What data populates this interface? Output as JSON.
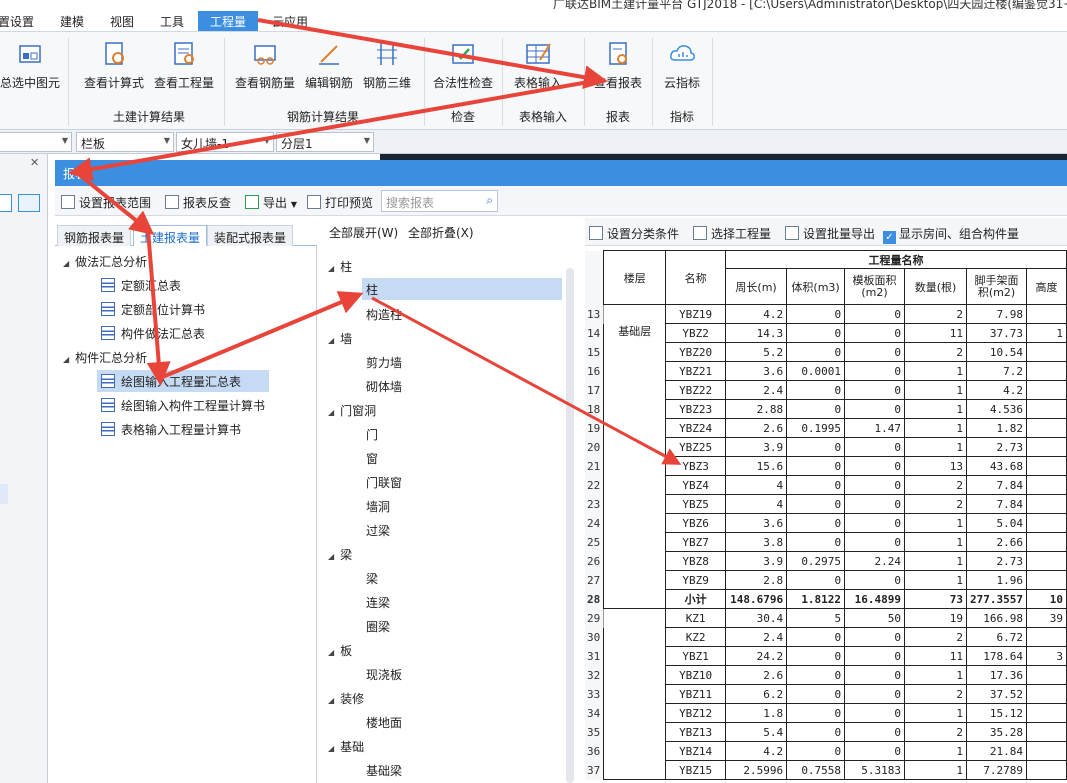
{
  "title_bar": {
    "text": "广联达BIM土建计量平台 GTJ2018 - [C:\\Users\\Administrator\\Desktop\\四天园迁楼(编鉴觉31+"
  },
  "menu": [
    {
      "label": "置设置"
    },
    {
      "label": "建模"
    },
    {
      "label": "视图"
    },
    {
      "label": "工具"
    },
    {
      "label": "工程量",
      "active": true
    },
    {
      "label": "云应用"
    }
  ],
  "ribbon": {
    "buttons": [
      {
        "label": "总选中图元",
        "icon": "select-element-icon"
      },
      {
        "label": "查看计算式",
        "icon": "view-formula-icon"
      },
      {
        "label": "查看工程量",
        "icon": "view-quantity-icon"
      },
      {
        "label": "查看钢筋量",
        "icon": "view-rebar-icon"
      },
      {
        "label": "编辑钢筋",
        "icon": "edit-rebar-icon"
      },
      {
        "label": "钢筋三维",
        "icon": "rebar-3d-icon"
      },
      {
        "label": "合法性检查",
        "icon": "validity-check-icon"
      },
      {
        "label": "表格输入",
        "icon": "table-input-icon"
      },
      {
        "label": "查看报表",
        "icon": "view-report-icon"
      },
      {
        "label": "云指标",
        "icon": "cloud-index-icon"
      }
    ],
    "groups": [
      "土建计算结果",
      "钢筋计算结果",
      "检查",
      "表格输入",
      "报表",
      "指标"
    ]
  },
  "combos": [
    "",
    "栏板",
    "女儿墙-1",
    "分层1"
  ],
  "report_panel": {
    "title": "报表",
    "toolbar": {
      "set_range": "设置报表范围",
      "reverse_check": "报表反查",
      "export": "导出",
      "print_preview": "打印预览",
      "search_placeholder": "搜索报表"
    },
    "tabs": [
      "钢筋报表量",
      "土建报表量",
      "装配式报表量"
    ],
    "active_tab": "土建报表量",
    "tree": [
      {
        "label": "做法汇总分析",
        "children": [
          "定额汇总表",
          "定额部位计算书",
          "构件做法汇总表"
        ]
      },
      {
        "label": "构件汇总分析",
        "children": [
          "绘图输入工程量汇总表",
          "绘图输入构件工程量计算书",
          "表格输入工程量计算书"
        ]
      }
    ],
    "selected_report": "绘图输入工程量汇总表",
    "expand_all": "全部展开(W)",
    "collapse_all": "全部折叠(X)",
    "category_tree": [
      {
        "label": "柱",
        "children": [
          "柱",
          "构造柱"
        ]
      },
      {
        "label": "墙",
        "children": [
          "剪力墙",
          "砌体墙"
        ]
      },
      {
        "label": "门窗洞",
        "children": [
          "门",
          "窗",
          "门联窗",
          "墙洞",
          "过梁"
        ]
      },
      {
        "label": "梁",
        "children": [
          "梁",
          "连梁",
          "圈梁"
        ]
      },
      {
        "label": "板",
        "children": [
          "现浇板"
        ]
      },
      {
        "label": "装修",
        "children": [
          "楼地面"
        ]
      },
      {
        "label": "基础",
        "children": [
          "基础梁"
        ]
      }
    ],
    "selected_category": "柱",
    "right_toolbar": {
      "set_condition": "设置分类条件",
      "select_quantity": "选择工程量",
      "batch_export": "设置批量导出",
      "show_rooms": "显示房间、组合构件量"
    },
    "table": {
      "group_header": "工程量名称",
      "headers": [
        "楼层",
        "名称",
        "周长(m)",
        "体积(m3)",
        "模板面积(m2)",
        "数量(根)",
        "脚手架面积(m2)",
        "高度"
      ],
      "floor_label": "基础层",
      "rows": [
        {
          "n": "13",
          "name": "YBZ19",
          "vals": [
            "4.2",
            "0",
            "0",
            "2",
            "7.98",
            ""
          ]
        },
        {
          "n": "14",
          "name": "YBZ2",
          "vals": [
            "14.3",
            "0",
            "0",
            "11",
            "37.73",
            "1"
          ]
        },
        {
          "n": "15",
          "name": "YBZ20",
          "vals": [
            "5.2",
            "0",
            "0",
            "2",
            "10.54",
            ""
          ]
        },
        {
          "n": "16",
          "name": "YBZ21",
          "vals": [
            "3.6",
            "0.0001",
            "0",
            "1",
            "7.2",
            ""
          ]
        },
        {
          "n": "17",
          "name": "YBZ22",
          "vals": [
            "2.4",
            "0",
            "0",
            "1",
            "4.2",
            ""
          ]
        },
        {
          "n": "18",
          "name": "YBZ23",
          "vals": [
            "2.88",
            "0",
            "0",
            "1",
            "4.536",
            ""
          ]
        },
        {
          "n": "19",
          "name": "YBZ24",
          "vals": [
            "2.6",
            "0.1995",
            "1.47",
            "1",
            "1.82",
            ""
          ]
        },
        {
          "n": "20",
          "name": "YBZ25",
          "vals": [
            "3.9",
            "0",
            "0",
            "1",
            "2.73",
            ""
          ]
        },
        {
          "n": "21",
          "name": "YBZ3",
          "vals": [
            "15.6",
            "0",
            "0",
            "13",
            "43.68",
            ""
          ]
        },
        {
          "n": "22",
          "name": "YBZ4",
          "vals": [
            "4",
            "0",
            "0",
            "2",
            "7.84",
            ""
          ]
        },
        {
          "n": "23",
          "name": "YBZ5",
          "vals": [
            "4",
            "0",
            "0",
            "2",
            "7.84",
            ""
          ]
        },
        {
          "n": "24",
          "name": "YBZ6",
          "vals": [
            "3.6",
            "0",
            "0",
            "1",
            "5.04",
            ""
          ]
        },
        {
          "n": "25",
          "name": "YBZ7",
          "vals": [
            "3.8",
            "0",
            "0",
            "1",
            "2.66",
            ""
          ]
        },
        {
          "n": "26",
          "name": "YBZ8",
          "vals": [
            "3.9",
            "0.2975",
            "2.24",
            "1",
            "2.73",
            ""
          ]
        },
        {
          "n": "27",
          "name": "YBZ9",
          "vals": [
            "2.8",
            "0",
            "0",
            "1",
            "1.96",
            ""
          ]
        },
        {
          "n": "28",
          "name": "小计",
          "vals": [
            "148.6796",
            "1.8122",
            "16.4899",
            "73",
            "277.3557",
            "10"
          ],
          "subtotal": true
        },
        {
          "n": "29",
          "name": "KZ1",
          "vals": [
            "30.4",
            "5",
            "50",
            "19",
            "166.98",
            "39"
          ]
        },
        {
          "n": "30",
          "name": "KZ2",
          "vals": [
            "2.4",
            "0",
            "0",
            "2",
            "6.72",
            ""
          ]
        },
        {
          "n": "31",
          "name": "YBZ1",
          "vals": [
            "24.2",
            "0",
            "0",
            "11",
            "178.64",
            "3"
          ]
        },
        {
          "n": "32",
          "name": "YBZ10",
          "vals": [
            "2.6",
            "0",
            "0",
            "1",
            "17.36",
            ""
          ]
        },
        {
          "n": "33",
          "name": "YBZ11",
          "vals": [
            "6.2",
            "0",
            "0",
            "2",
            "37.52",
            ""
          ]
        },
        {
          "n": "34",
          "name": "YBZ12",
          "vals": [
            "1.8",
            "0",
            "0",
            "1",
            "15.12",
            ""
          ]
        },
        {
          "n": "35",
          "name": "YBZ13",
          "vals": [
            "5.4",
            "0",
            "0",
            "2",
            "35.28",
            ""
          ]
        },
        {
          "n": "36",
          "name": "YBZ14",
          "vals": [
            "4.2",
            "0",
            "0",
            "1",
            "21.84",
            ""
          ]
        },
        {
          "n": "37",
          "name": "YBZ15",
          "vals": [
            "2.5996",
            "0.7558",
            "5.3183",
            "1",
            "7.2789",
            ""
          ]
        }
      ]
    }
  },
  "colors": {
    "accent": "#3b8ee0",
    "arrow": "#e8443a",
    "selection": "#c5daf3"
  }
}
